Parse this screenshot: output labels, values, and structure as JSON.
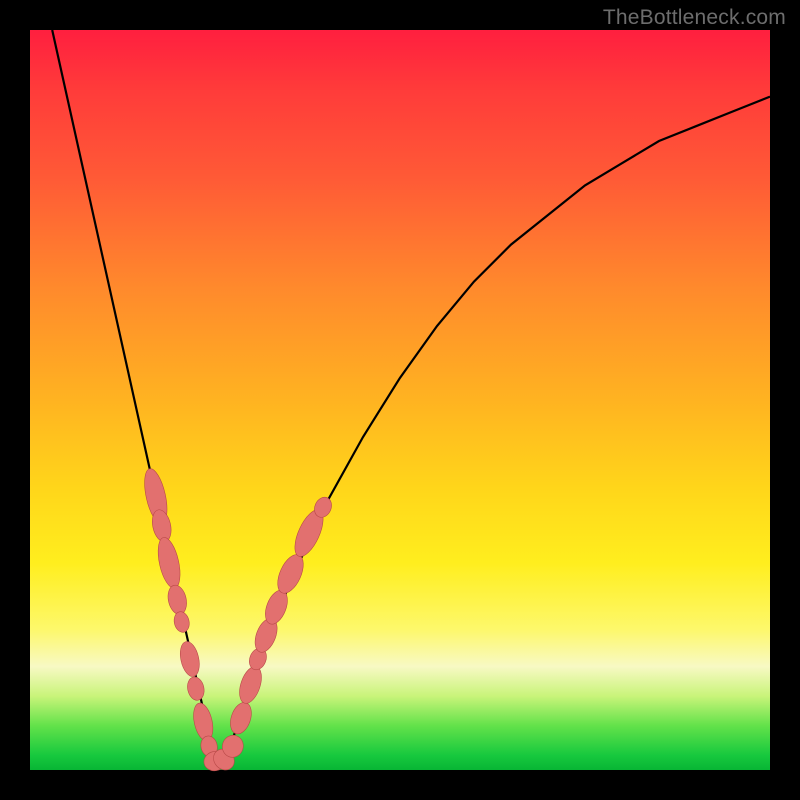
{
  "watermark": "TheBottleneck.com",
  "colors": {
    "bead_fill": "#e2706f",
    "bead_stroke": "#b94948",
    "curve_stroke": "#000000",
    "frame": "#000000"
  },
  "chart_data": {
    "type": "line",
    "title": "",
    "xlabel": "",
    "ylabel": "",
    "xlim": [
      0,
      100
    ],
    "ylim": [
      0,
      100
    ],
    "note": "V-shaped bottleneck curve; y≈0 at x≈25; beads mark highlighted points near the valley",
    "series": [
      {
        "name": "curve",
        "x": [
          3,
          5,
          7,
          9,
          11,
          13,
          15,
          17,
          19,
          21,
          23,
          25,
          27,
          30,
          35,
          40,
          45,
          50,
          55,
          60,
          65,
          70,
          75,
          80,
          85,
          90,
          95,
          100
        ],
        "y": [
          100,
          91,
          82,
          73,
          64,
          55,
          46,
          37,
          28,
          19,
          10,
          1,
          3,
          12,
          25,
          36,
          45,
          53,
          60,
          66,
          71,
          75,
          79,
          82,
          85,
          87,
          89,
          91
        ]
      }
    ],
    "beads": [
      {
        "cx": 17.0,
        "cy": 37,
        "rx": 1.3,
        "ry": 3.8
      },
      {
        "cx": 17.8,
        "cy": 33,
        "rx": 1.2,
        "ry": 2.2
      },
      {
        "cx": 18.8,
        "cy": 28,
        "rx": 1.3,
        "ry": 3.5
      },
      {
        "cx": 19.9,
        "cy": 23,
        "rx": 1.2,
        "ry": 2.0
      },
      {
        "cx": 20.5,
        "cy": 20,
        "rx": 1.0,
        "ry": 1.4
      },
      {
        "cx": 21.6,
        "cy": 15,
        "rx": 1.2,
        "ry": 2.4
      },
      {
        "cx": 22.4,
        "cy": 11,
        "rx": 1.1,
        "ry": 1.6
      },
      {
        "cx": 23.4,
        "cy": 6.5,
        "rx": 1.2,
        "ry": 2.6
      },
      {
        "cx": 24.2,
        "cy": 3.2,
        "rx": 1.1,
        "ry": 1.4
      },
      {
        "cx": 25.0,
        "cy": 1.2,
        "rx": 1.5,
        "ry": 1.3
      },
      {
        "cx": 26.2,
        "cy": 1.4,
        "rx": 1.5,
        "ry": 1.3
      },
      {
        "cx": 27.4,
        "cy": 3.2,
        "rx": 1.4,
        "ry": 1.5
      },
      {
        "cx": 28.5,
        "cy": 7.0,
        "rx": 1.3,
        "ry": 2.2
      },
      {
        "cx": 29.8,
        "cy": 11.5,
        "rx": 1.3,
        "ry": 2.6
      },
      {
        "cx": 30.8,
        "cy": 15.0,
        "rx": 1.1,
        "ry": 1.5
      },
      {
        "cx": 31.9,
        "cy": 18.2,
        "rx": 1.3,
        "ry": 2.4
      },
      {
        "cx": 33.3,
        "cy": 22.0,
        "rx": 1.3,
        "ry": 2.4
      },
      {
        "cx": 35.2,
        "cy": 26.5,
        "rx": 1.4,
        "ry": 2.8
      },
      {
        "cx": 37.7,
        "cy": 32.0,
        "rx": 1.4,
        "ry": 3.4
      },
      {
        "cx": 39.6,
        "cy": 35.5,
        "rx": 1.1,
        "ry": 1.4
      }
    ]
  }
}
